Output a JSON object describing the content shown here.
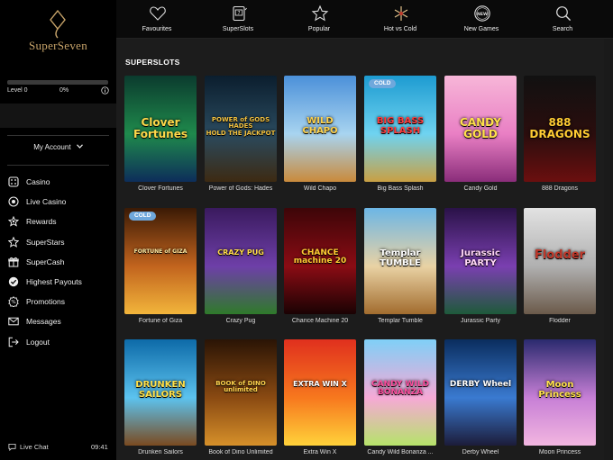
{
  "brand": {
    "name": "SuperSeven"
  },
  "level": {
    "label": "Level 0",
    "percent": "0%",
    "progress": 0
  },
  "account": {
    "label": "My Account"
  },
  "menu": [
    {
      "label": "Casino",
      "icon": "casino-icon"
    },
    {
      "label": "Live Casino",
      "icon": "live-casino-icon"
    },
    {
      "label": "Rewards",
      "icon": "rewards-icon"
    },
    {
      "label": "SuperStars",
      "icon": "star-icon"
    },
    {
      "label": "SuperCash",
      "icon": "gift-icon"
    },
    {
      "label": "Highest Payouts",
      "icon": "check-icon"
    },
    {
      "label": "Promotions",
      "icon": "promotions-icon"
    },
    {
      "label": "Messages",
      "icon": "mail-icon"
    },
    {
      "label": "Logout",
      "icon": "logout-icon"
    }
  ],
  "footer": {
    "chat": "Live Chat",
    "time": "09:41"
  },
  "nav": [
    {
      "label": "Favourites",
      "icon": "heart-icon"
    },
    {
      "label": "SuperSlots",
      "icon": "slot-machine-icon"
    },
    {
      "label": "Popular",
      "icon": "star-icon"
    },
    {
      "label": "Hot vs Cold",
      "icon": "snowflake-icon"
    },
    {
      "label": "New Games",
      "icon": "new-badge-icon"
    },
    {
      "label": "Search",
      "icon": "search-icon"
    }
  ],
  "section": {
    "title": "SUPERSLOTS"
  },
  "games": [
    {
      "name": "Clover Fortunes",
      "art": "Clover\nFortunes",
      "badge": ""
    },
    {
      "name": "Power of Gods: Hades",
      "art": "POWER of GODS\nHADES\nHOLD THE JACKPOT",
      "badge": ""
    },
    {
      "name": "Wild Chapo",
      "art": "WILD\nCHAPO",
      "badge": ""
    },
    {
      "name": "Big Bass Splash",
      "art": "BIG BASS\nSPLASH",
      "badge": "COLD"
    },
    {
      "name": "Candy Gold",
      "art": "CANDY\nGOLD",
      "badge": ""
    },
    {
      "name": "888 Dragons",
      "art": "888\nDRAGONS",
      "badge": ""
    },
    {
      "name": "Fortune of Giza",
      "art": "FORTUNE of GIZA",
      "badge": "COLD"
    },
    {
      "name": "Crazy Pug",
      "art": "CRAZY PUG",
      "badge": ""
    },
    {
      "name": "Chance Machine 20",
      "art": "CHANCE\nmachine 20",
      "badge": ""
    },
    {
      "name": "Templar Tumble",
      "art": "Templar\nTUMBLE",
      "badge": ""
    },
    {
      "name": "Jurassic Party",
      "art": "Jurassic\nPARTY",
      "badge": ""
    },
    {
      "name": "Flodder",
      "art": "Flodder",
      "badge": ""
    },
    {
      "name": "Drunken Sailors",
      "art": "DRUNKEN\nSAILORS",
      "badge": ""
    },
    {
      "name": "Book of Dino Unlimited",
      "art": "BOOK of DINO\nunlimited",
      "badge": ""
    },
    {
      "name": "Extra Win X",
      "art": "EXTRA WIN X",
      "badge": ""
    },
    {
      "name": "Candy Wild Bonanza ...",
      "art": "CANDY WILD\nBONANZA",
      "badge": ""
    },
    {
      "name": "Derby Wheel",
      "art": "DERBY Wheel",
      "badge": ""
    },
    {
      "name": "Moon Princess",
      "art": "Moon\nPrincess",
      "badge": ""
    }
  ],
  "colors": {
    "accent": "#c8a46a",
    "badge": "#6fa8dc",
    "sidebar": "#000000",
    "content": "#1c1c1c"
  }
}
